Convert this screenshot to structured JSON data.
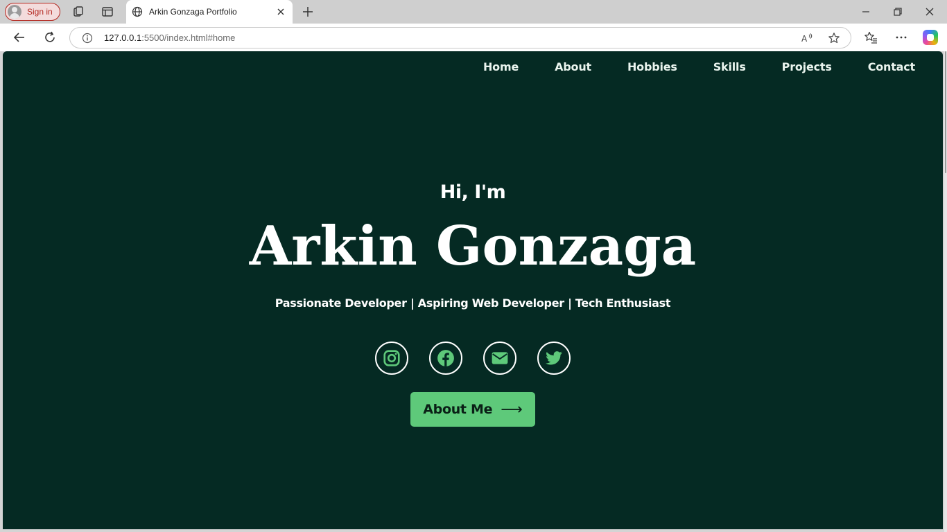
{
  "browser": {
    "signin_label": "Sign in",
    "tab_title": "Arkin Gonzaga Portfolio",
    "url_host": "127.0.0.1",
    "url_rest": ":5500/index.html#home"
  },
  "nav": {
    "items": [
      "Home",
      "About",
      "Hobbies",
      "Skills",
      "Projects",
      "Contact"
    ]
  },
  "hero": {
    "greeting": "Hi, I'm",
    "name": "Arkin Gonzaga",
    "tagline": "Passionate Developer | Aspiring Web Developer | Tech Enthusiast",
    "socials": [
      "instagram-icon",
      "facebook-icon",
      "email-icon",
      "twitter-icon"
    ],
    "cta_label": "About Me",
    "cta_arrow": "⟶"
  },
  "colors": {
    "page_bg": "#052a23",
    "accent": "#5ec97a",
    "text": "#ffffff"
  }
}
